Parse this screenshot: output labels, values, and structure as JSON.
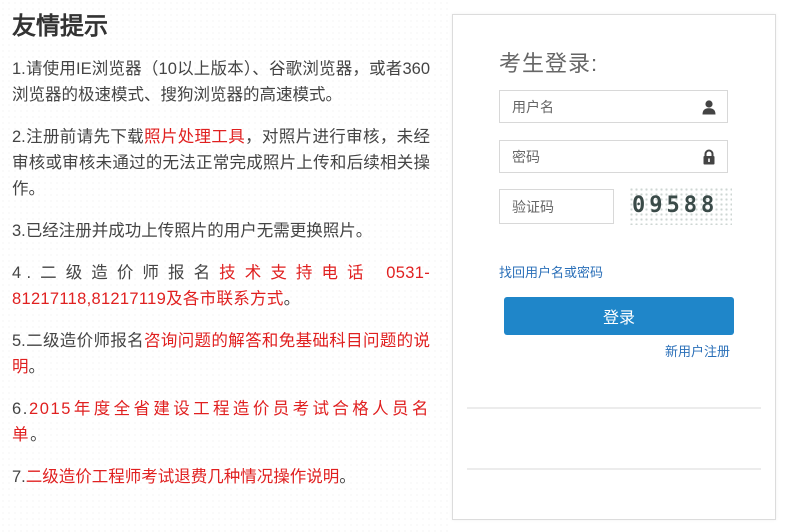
{
  "tips": {
    "heading": "友情提示",
    "item1": "1.请使用IE浏览器（10以上版本）、谷歌浏览器，或者360浏览器的极速模式、搜狗浏览器的高速模式。",
    "item2_pre": "2.注册前请先下载",
    "item2_link": "照片处理工具",
    "item2_post": "，对照片进行审核，未经审核或审核未通过的无法正常完成照片上传和后续相关操作。",
    "item3": "3.已经注册并成功上传照片的用户无需更换照片。",
    "item4_pre": "4.二级造价师报名",
    "item4_link": "技术支持电话",
    "item4_link2": "0531-81217118,81217119及各市联系方式",
    "item4_post": "。",
    "item5_pre": "5.二级造价师报名",
    "item5_link": "咨询问题的解答和免基础科目问题的说明",
    "item5_post": "。",
    "item6_pre": "6.",
    "item6_link": "2015年度全省建设工程造价员考试合格人员名单",
    "item6_post": "。",
    "item7_pre": "7.",
    "item7_link": "二级造价工程师考试退费几种情况操作说明",
    "item7_post": "。"
  },
  "login": {
    "title": "考生登录:",
    "username_placeholder": "用户名",
    "password_placeholder": "密码",
    "captcha_placeholder": "验证码",
    "captcha_text": "09588",
    "forgot_label": "找回用户名或密码",
    "submit_label": "登录",
    "register_label": "新用户注册"
  },
  "icons": {
    "username": "user-icon",
    "password": "lock-icon"
  },
  "colors": {
    "link_red": "#e02020",
    "button_blue": "#1f86c9",
    "link_blue": "#2a6fb8"
  }
}
